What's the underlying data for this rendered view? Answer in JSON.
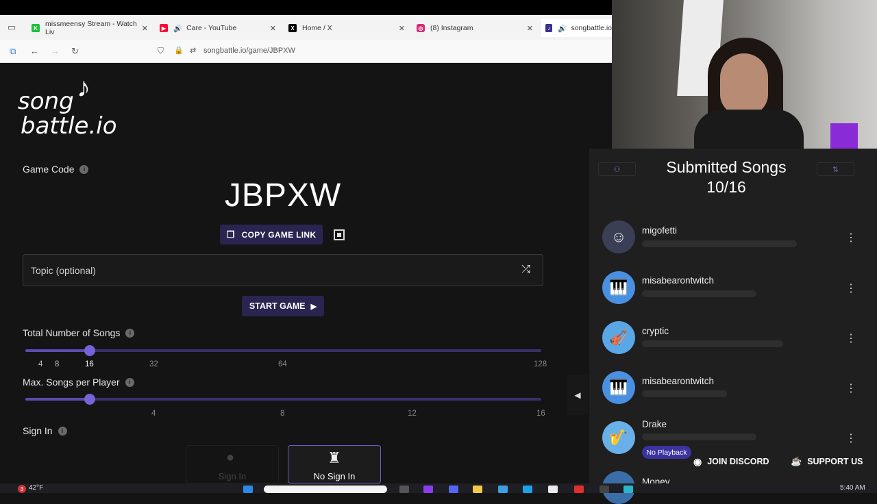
{
  "browser": {
    "tabs": [
      {
        "title": "missmeensy Stream - Watch Liv",
        "color": "#18c23a"
      },
      {
        "title": "Care - YouTube",
        "color": "#ff0033"
      },
      {
        "title": "Home / X",
        "color": "#000000"
      },
      {
        "title": "(8) Instagram",
        "color": "#d62976"
      },
      {
        "title": "songbattle.io",
        "color": "#3b2f8f"
      }
    ],
    "url": "songbattle.io/game/JBPXW"
  },
  "logo": {
    "line1": "song",
    "line2": "battle.io"
  },
  "game": {
    "code_label": "Game Code",
    "code": "JBPXW",
    "copy_label": "COPY GAME LINK",
    "topic_placeholder": "Topic (optional)",
    "start_label": "START GAME"
  },
  "settings": {
    "total_songs": {
      "label": "Total Number of Songs",
      "ticks": [
        "4",
        "8",
        "16",
        "32",
        "64",
        "128"
      ],
      "value": 16
    },
    "max_per_player": {
      "label": "Max. Songs per Player",
      "ticks": [
        "4",
        "8",
        "12",
        "16"
      ],
      "value": 2
    },
    "sign_in": {
      "label": "Sign In",
      "options": [
        "Sign In",
        "No Sign In"
      ],
      "selected": "No Sign In"
    }
  },
  "submitted": {
    "title": "Submitted Songs",
    "count": "10/16",
    "entries": [
      {
        "name": "migofetti",
        "avatar_color": "#3b3f56"
      },
      {
        "name": "misabearontwitch",
        "avatar_color": "#4a90e2"
      },
      {
        "name": "cryptic",
        "avatar_color": "#5aa7e8"
      },
      {
        "name": "misabearontwitch",
        "avatar_color": "#4a90e2"
      },
      {
        "name": "Drake",
        "avatar_color": "#6ab0e8"
      },
      {
        "name": "Money",
        "avatar_color": "#3a6ea8"
      }
    ],
    "no_playback": "No Playback"
  },
  "footer": {
    "discord": "JOIN DISCORD",
    "support": "SUPPORT US"
  },
  "taskbar": {
    "weather": "42°F",
    "notifications": "3",
    "time": "5:40 AM"
  }
}
